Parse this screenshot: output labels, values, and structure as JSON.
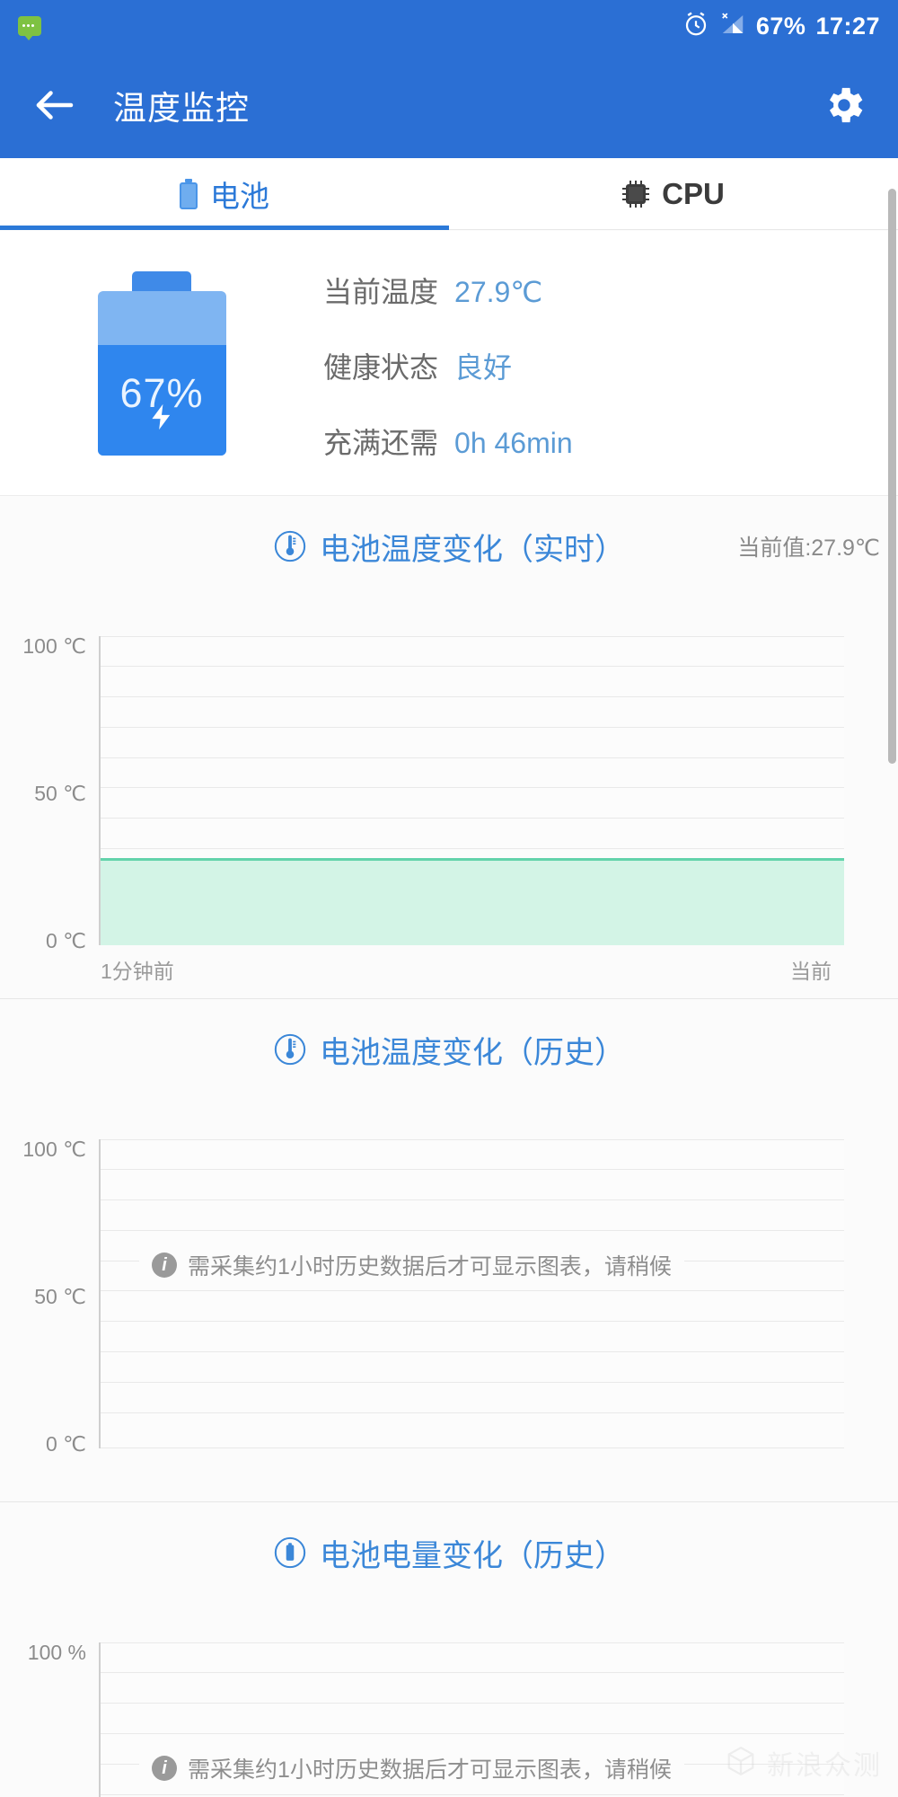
{
  "status_bar": {
    "message_icon": "message-bubble-icon",
    "alarm_icon": "alarm-clock-icon",
    "signal_icon": "signal-no-service-icon",
    "battery_percent": "67%",
    "time": "17:27"
  },
  "app_bar": {
    "back_icon": "back-arrow-icon",
    "title": "温度监控",
    "settings_icon": "gear-icon"
  },
  "tabs": [
    {
      "label": "电池",
      "icon": "battery-icon",
      "active": true
    },
    {
      "label": "CPU",
      "icon": "cpu-chip-icon",
      "active": false
    }
  ],
  "summary": {
    "battery_level_text": "67%",
    "battery_level_value": 67,
    "charging_icon": "lightning-bolt-icon",
    "rows": [
      {
        "label": "当前温度",
        "value": "27.9℃"
      },
      {
        "label": "健康状态",
        "value": "良好"
      },
      {
        "label": "充满还需",
        "value": "0h 46min"
      }
    ]
  },
  "sections": [
    {
      "title": "电池温度变化（实时）",
      "icon": "thermometer-icon",
      "current_label": "当前值:27.9℃"
    },
    {
      "title": "电池温度变化（历史）",
      "icon": "thermometer-icon",
      "empty_message": "需采集约1小时历史数据后才可显示图表，请稍候",
      "empty_icon": "info-icon"
    },
    {
      "title": "电池电量变化（历史）",
      "icon": "battery-circle-icon",
      "empty_message": "需采集约1小时历史数据后才可显示图表，请稍候",
      "empty_icon": "info-icon"
    }
  ],
  "watermark": {
    "text": "新浪众测",
    "icon": "cube-logo-icon"
  },
  "theme": {
    "primary": "#2b6fd4",
    "accent": "#3b87d8",
    "value_text": "#5b9bd5",
    "area_fill": "#d3f4e6",
    "area_line": "#63d3ab"
  },
  "chart_data": [
    {
      "type": "area",
      "title": "电池温度变化（实时）",
      "ylabel": "",
      "ytick_labels": [
        "0 ℃",
        "50 ℃",
        "100 ℃"
      ],
      "ytick_values": [
        0,
        50,
        100
      ],
      "ylim": [
        0,
        100
      ],
      "gridlines_every": 10,
      "grid": true,
      "xlabels": [
        "1分钟前",
        "当前"
      ],
      "series": [
        {
          "name": "电池温度",
          "values": [
            27.9,
            27.9,
            27.9,
            27.9,
            27.9,
            27.9,
            27.9,
            27.9,
            27.9,
            27.9
          ]
        }
      ],
      "current_value": 27.9,
      "unit": "℃",
      "annotation": "当前值:27.9℃"
    },
    {
      "type": "area",
      "title": "电池温度变化（历史）",
      "ytick_labels": [
        "0 ℃",
        "50 ℃",
        "100 ℃"
      ],
      "ytick_values": [
        0,
        50,
        100
      ],
      "ylim": [
        0,
        100
      ],
      "gridlines_every": 10,
      "grid": true,
      "series": [],
      "empty": true,
      "empty_message": "需采集约1小时历史数据后才可显示图表，请稍候"
    },
    {
      "type": "area",
      "title": "电池电量变化（历史）",
      "ytick_labels": [
        "100 %"
      ],
      "ytick_values": [
        100
      ],
      "ylim": [
        0,
        100
      ],
      "gridlines_every": 10,
      "grid": true,
      "series": [],
      "empty": true,
      "empty_message": "需采集约1小时历史数据后才可显示图表，请稍候"
    }
  ]
}
